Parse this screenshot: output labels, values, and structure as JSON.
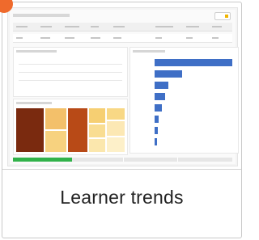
{
  "card": {
    "title": "Learner trends",
    "accent_color": "#ef6a2c"
  },
  "thumbnail": {
    "header_columns": 10,
    "bar_chart": {
      "bar_color": "#3f6fc6",
      "values": [
        1.0,
        0.35,
        0.18,
        0.14,
        0.09,
        0.05,
        0.04,
        0.03
      ]
    },
    "progress": {
      "fill_fraction": 0.27,
      "fill_color": "#31b24a"
    }
  }
}
